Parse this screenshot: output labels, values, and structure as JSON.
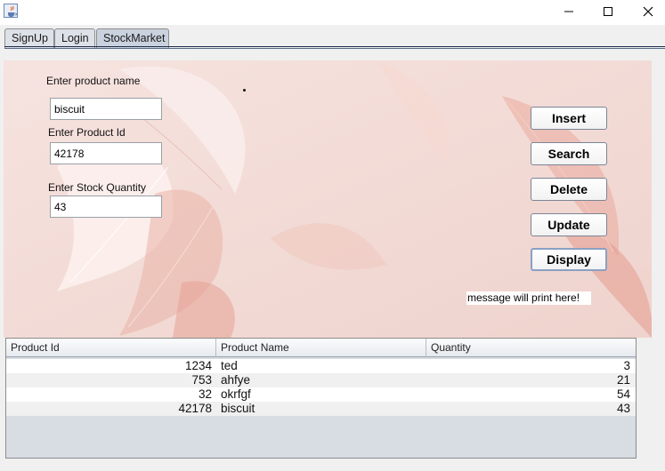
{
  "window": {
    "icon": "java-cup-icon",
    "controls": [
      "minimize-icon",
      "maximize-icon",
      "close-icon"
    ]
  },
  "tabs": [
    {
      "label": "SignUp"
    },
    {
      "label": "Login"
    },
    {
      "label": "StockMarket",
      "selected": true
    }
  ],
  "form": {
    "name_label": "Enter product name",
    "name_value": "biscuit",
    "id_label": "Enter Product Id",
    "id_value": "42178",
    "qty_label": "Enter Stock Quantity",
    "qty_value": "43"
  },
  "buttons": {
    "insert": "Insert",
    "search": "Search",
    "delete": "Delete",
    "update": "Update",
    "display": "Display"
  },
  "message": "message will print here!",
  "table": {
    "headers": [
      "Product Id",
      "Product Name",
      "Quantity"
    ],
    "rows": [
      [
        "1234",
        "ted",
        "3"
      ],
      [
        "753",
        "ahfye",
        "21"
      ],
      [
        "32",
        "okrfgf",
        "54"
      ],
      [
        "42178",
        "biscuit",
        "43"
      ]
    ]
  },
  "colors": {
    "panel_background": "#f3dcd8",
    "feather_accent": "#e8a49a"
  }
}
